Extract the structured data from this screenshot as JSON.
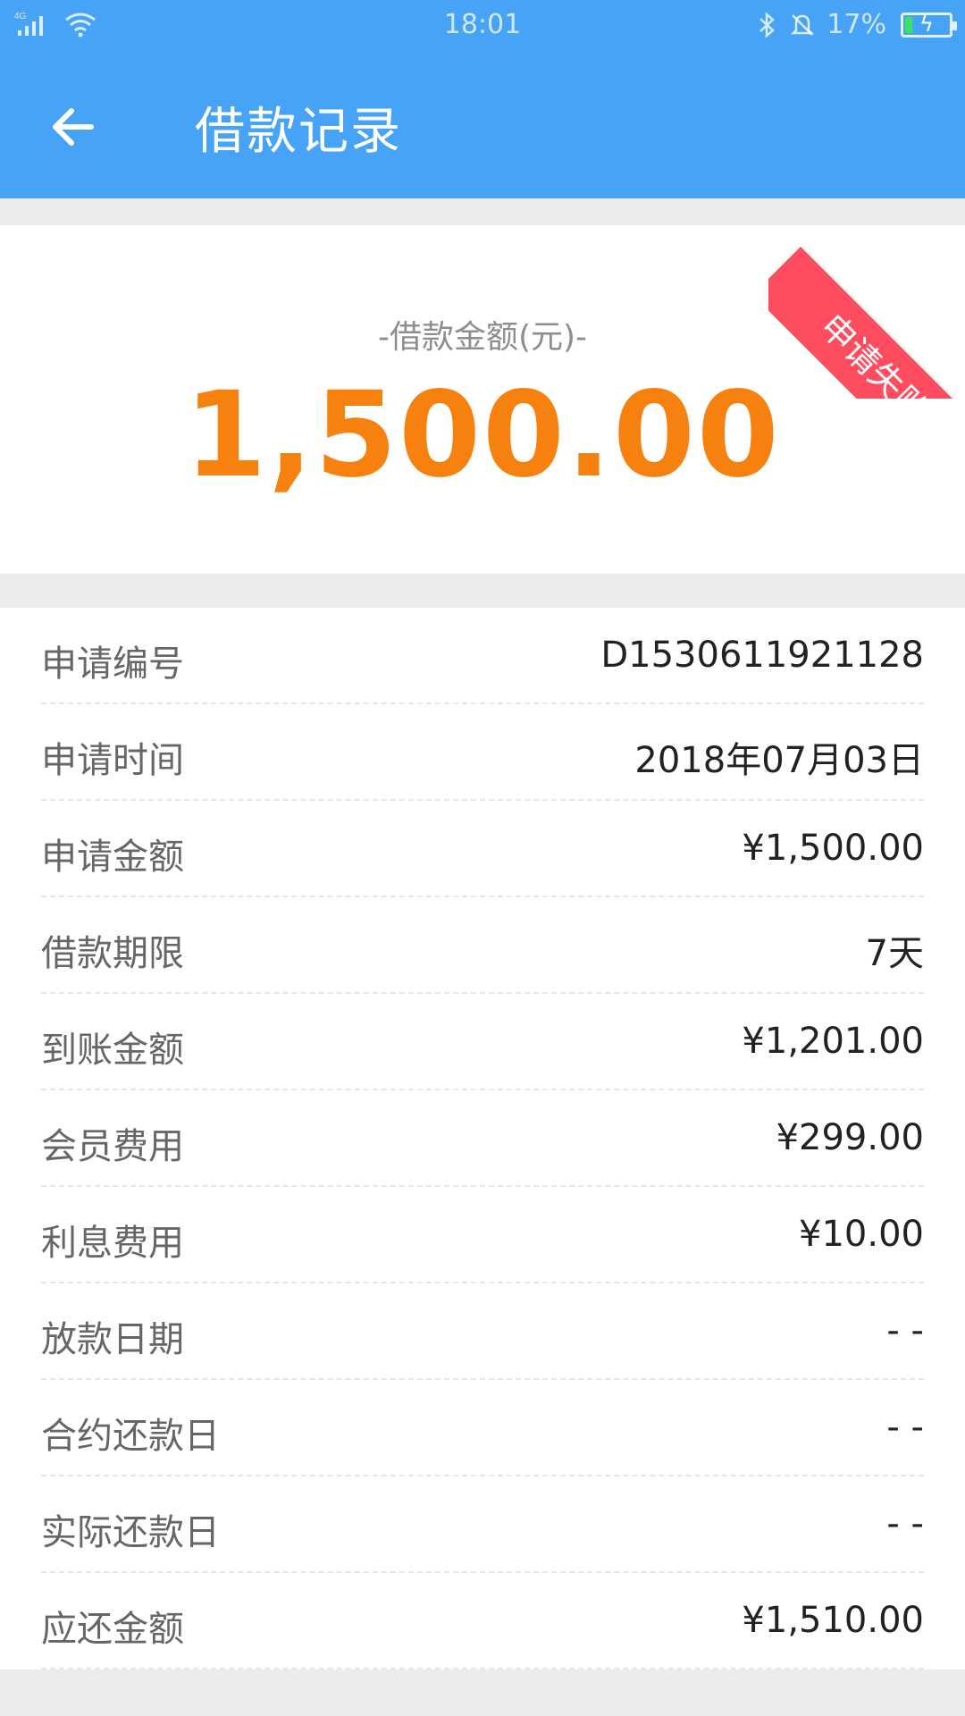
{
  "status_bar": {
    "network": "4G",
    "time": "18:01",
    "battery": "17%",
    "battery_level": 0.17
  },
  "header": {
    "title": "借款记录"
  },
  "summary": {
    "caption": "-借款金额(元)-",
    "amount": "1,500.00",
    "status_ribbon": "申请失败",
    "colors": {
      "amount": "#f7810f",
      "ribbon": "#ff4d5f",
      "header": "#46a3f6"
    }
  },
  "details": {
    "rows": [
      {
        "label": "申请编号",
        "value": "D1530611921128"
      },
      {
        "label": "申请时间",
        "value": "2018年07月03日"
      },
      {
        "label": "申请金额",
        "value": "¥1,500.00"
      },
      {
        "label": "借款期限",
        "value": "7天"
      },
      {
        "label": "到账金额",
        "value": "¥1,201.00"
      },
      {
        "label": "会员费用",
        "value": "¥299.00"
      },
      {
        "label": "利息费用",
        "value": "¥10.00"
      },
      {
        "label": "放款日期",
        "value": "- -"
      },
      {
        "label": "合约还款日",
        "value": "- -"
      },
      {
        "label": "实际还款日",
        "value": "- -"
      },
      {
        "label": "应还金额",
        "value": "¥1,510.00"
      }
    ]
  }
}
